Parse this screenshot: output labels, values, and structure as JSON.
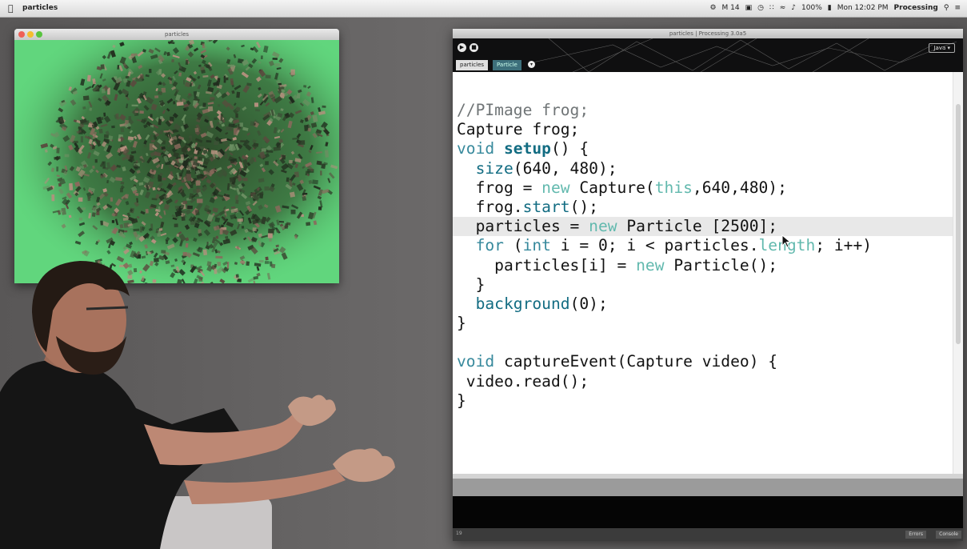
{
  "menubar": {
    "app_name": "particles",
    "right_items": [
      "M 14",
      "100%",
      "Mon 12:02 PM",
      "Processing"
    ]
  },
  "sketch_window": {
    "title": "particles"
  },
  "ide": {
    "window_title": "particles | Processing 3.0a5",
    "tabs": [
      "particles",
      "Particle"
    ],
    "mode_label": "Java ▾",
    "footer_buttons": [
      "Errors",
      "Console"
    ],
    "footer_line": "19",
    "code_lines": [
      [
        [
          "//PImage frog;",
          "comment"
        ]
      ],
      [
        [
          "Capture frog;",
          "plain"
        ]
      ],
      [
        [
          "void ",
          "kw"
        ],
        [
          "setup",
          "bold"
        ],
        [
          "() {",
          "plain"
        ]
      ],
      [
        [
          "  ",
          "plain"
        ],
        [
          "size",
          "fn"
        ],
        [
          "(640, 480);",
          "plain"
        ]
      ],
      [
        [
          "  frog = ",
          "plain"
        ],
        [
          "new",
          "kw2"
        ],
        [
          " Capture(",
          "plain"
        ],
        [
          "this",
          "kw2"
        ],
        [
          ",640,480);",
          "plain"
        ]
      ],
      [
        [
          "  frog.",
          "plain"
        ],
        [
          "start",
          "fn"
        ],
        [
          "();",
          "plain"
        ]
      ],
      [
        [
          "  particles = ",
          "plain"
        ],
        [
          "new",
          "kw2"
        ],
        [
          " Particle [2500];",
          "plain"
        ]
      ],
      [
        [
          "  ",
          "plain"
        ],
        [
          "for",
          "kw"
        ],
        [
          " (",
          "plain"
        ],
        [
          "int",
          "kw"
        ],
        [
          " i = 0; i < particles.",
          "plain"
        ],
        [
          "length",
          "kw2"
        ],
        [
          "; i++)",
          "plain"
        ]
      ],
      [
        [
          "    particles[i] = ",
          "plain"
        ],
        [
          "new",
          "kw2"
        ],
        [
          " Particle();",
          "plain"
        ]
      ],
      [
        [
          "  }",
          "plain"
        ]
      ],
      [
        [
          "  ",
          "plain"
        ],
        [
          "background",
          "fn"
        ],
        [
          "(0);",
          "plain"
        ]
      ],
      [
        [
          "}",
          "plain"
        ]
      ],
      [
        [
          "",
          "plain"
        ]
      ],
      [
        [
          "void",
          "kw"
        ],
        [
          " captureEvent(Capture video) {",
          "plain"
        ]
      ],
      [
        [
          " video.read();",
          "plain"
        ]
      ],
      [
        [
          "}",
          "plain"
        ]
      ]
    ],
    "highlight_line": 6
  },
  "colors": {
    "keyword": "#37899c",
    "keyword_light": "#62b9ae",
    "comment": "#6f7476",
    "greenscreen": "#5ed07a"
  }
}
